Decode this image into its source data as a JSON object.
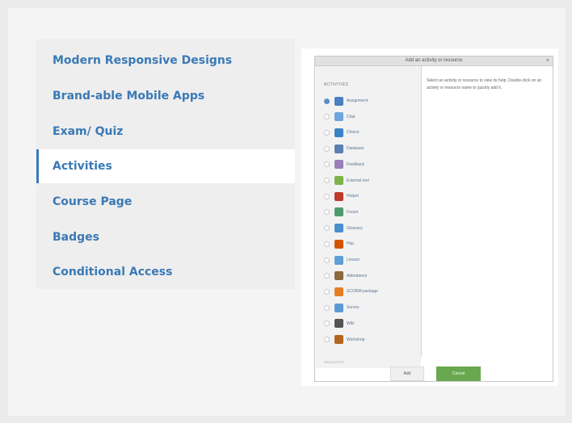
{
  "nav": {
    "items": [
      {
        "label": "Modern Responsive Designs",
        "active": false
      },
      {
        "label": "Brand-able Mobile Apps",
        "active": false
      },
      {
        "label": "Exam/ Quiz",
        "active": false
      },
      {
        "label": "Activities",
        "active": true
      },
      {
        "label": "Course Page",
        "active": false
      },
      {
        "label": "Badges",
        "active": false
      },
      {
        "label": "Conditional Access",
        "active": false
      }
    ]
  },
  "dialog": {
    "title": "Add an activity or resource",
    "close": "×",
    "section_header": "ACTIVITIES",
    "activities": [
      {
        "label": "Assignment",
        "icon": "assignment-icon",
        "color": "#4a7fc1",
        "selected": true
      },
      {
        "label": "Chat",
        "icon": "chat-icon",
        "color": "#6fa6dd",
        "selected": false
      },
      {
        "label": "Choice",
        "icon": "choice-icon",
        "color": "#3b82c4",
        "selected": false
      },
      {
        "label": "Database",
        "icon": "database-icon",
        "color": "#5b7fb3",
        "selected": false
      },
      {
        "label": "Feedback",
        "icon": "feedback-icon",
        "color": "#9a7fb8",
        "selected": false
      },
      {
        "label": "External tool",
        "icon": "external-tool-icon",
        "color": "#7fb24a",
        "selected": false
      },
      {
        "label": "Hotpot",
        "icon": "hotpot-icon",
        "color": "#c0392b",
        "selected": false
      },
      {
        "label": "Forum",
        "icon": "forum-icon",
        "color": "#4c9c6a",
        "selected": false
      },
      {
        "label": "Glossary",
        "icon": "glossary-icon",
        "color": "#4a8fd0",
        "selected": false
      },
      {
        "label": "Hvp",
        "icon": "hvp-icon",
        "color": "#d35400",
        "selected": false
      },
      {
        "label": "Lesson",
        "icon": "lesson-icon",
        "color": "#5d9fd6",
        "selected": false
      },
      {
        "label": "Attendance",
        "icon": "attendance-icon",
        "color": "#8b6a3b",
        "selected": false
      },
      {
        "label": "SCORM package",
        "icon": "scorm-icon",
        "color": "#e67e22",
        "selected": false
      },
      {
        "label": "Survey",
        "icon": "survey-icon",
        "color": "#5b9bd5",
        "selected": false
      },
      {
        "label": "Wiki",
        "icon": "wiki-icon",
        "color": "#555555",
        "selected": false
      },
      {
        "label": "Workshop",
        "icon": "workshop-icon",
        "color": "#b5651d",
        "selected": false
      }
    ],
    "resources_header": "RESOURCES",
    "description": "Select an activity or resource to view its help. Double-click on an activity or resource name to quickly add it.",
    "add_label": "Add",
    "cancel_label": "Cancel"
  }
}
